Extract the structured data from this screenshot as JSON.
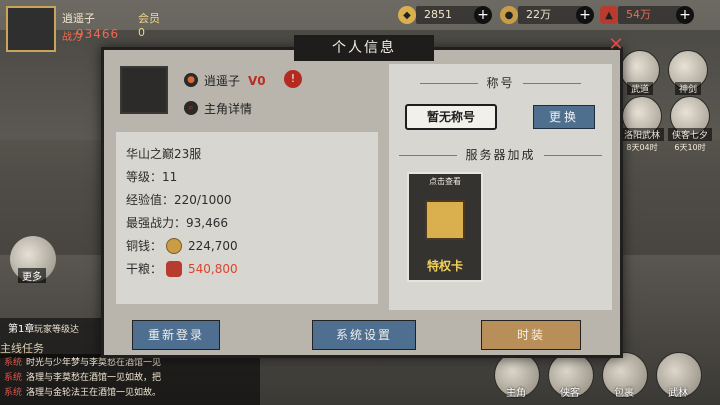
{
  "player": {
    "name": "逍遥子",
    "vip": "会员0",
    "power_label": "战力",
    "power": "93466"
  },
  "currency": [
    {
      "icon": "ingot-icon",
      "value": "2851"
    },
    {
      "icon": "coin-icon",
      "value": "22万"
    },
    {
      "icon": "ration-icon",
      "value": "54万"
    }
  ],
  "side_icons": [
    {
      "label": "武道",
      "timer": ""
    },
    {
      "label": "神剑",
      "timer": ""
    },
    {
      "label": "洛阳武林",
      "timer": "8天04时"
    },
    {
      "label": "侠客七夕",
      "timer": "6天10时"
    }
  ],
  "left": {
    "more": "更多",
    "quest_chapter": "第1章",
    "quest_title": "玩家等级达",
    "quest_main": "主线任务"
  },
  "chat": [
    {
      "tag": "系统",
      "text": "时光与少年梦与李莫愁在酒馆一见"
    },
    {
      "tag": "系统",
      "text": "洛理与李莫愁在酒馆一见如故，把"
    },
    {
      "tag": "系统",
      "text": "洛理与金轮法王在酒馆一见如故。"
    }
  ],
  "bottom_nav": [
    "主角",
    "侠客",
    "包裹",
    "武林"
  ],
  "modal": {
    "title": "个人信息",
    "name": "逍遥子",
    "vip_tag": "V0",
    "detail_link": "主角详情",
    "server": "华山之巅23服",
    "level_label": "等级：",
    "level": "11",
    "exp_label": "经验值：",
    "exp": "220/1000",
    "power_label": "最强战力：",
    "power": "93,466",
    "copper_label": "铜钱：",
    "copper": "224,700",
    "ration_label": "干粮：",
    "ration": "540,800",
    "title_section": "称号",
    "title_badge": "暂无称号",
    "change_btn": "更换",
    "bonus_section": "服务器加成",
    "card_top": "点击查看",
    "card_label": "特权卡",
    "btn_relogin": "重新登录",
    "btn_settings": "系统设置",
    "btn_fashion": "时装"
  }
}
